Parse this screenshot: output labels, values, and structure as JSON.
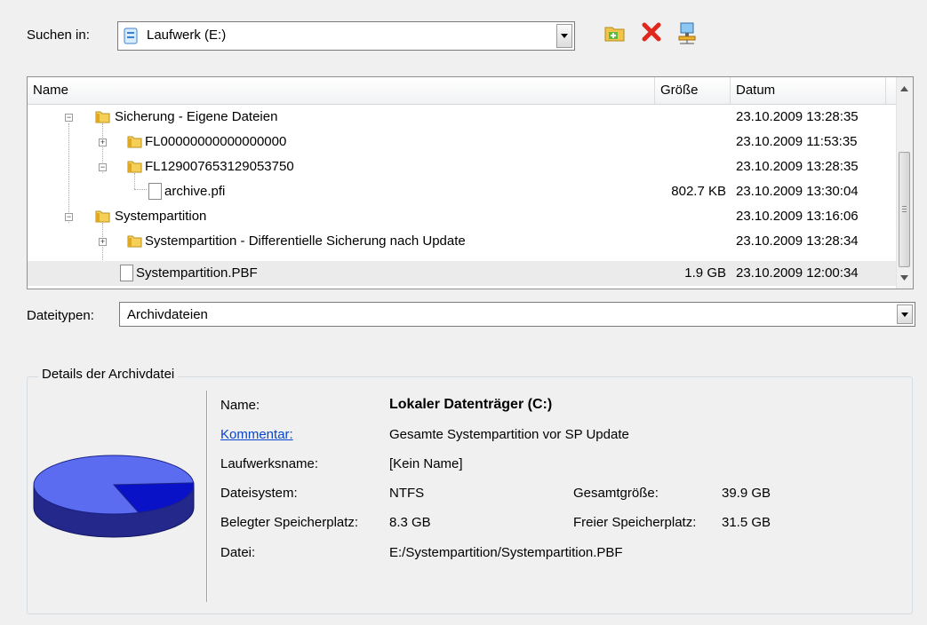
{
  "look_in": {
    "label": "Suchen in:",
    "value": "Laufwerk (E:)"
  },
  "toolbar": {
    "icons": [
      "new-folder-icon",
      "delete-icon",
      "network-icon"
    ]
  },
  "columns": {
    "name": "Name",
    "size": "Größe",
    "date": "Datum"
  },
  "rows": [
    {
      "name": "Sicherung - Eigene Dateien",
      "size": "",
      "date": "23.10.2009 13:28:35"
    },
    {
      "name": "FL00000000000000000",
      "size": "",
      "date": "23.10.2009 11:53:35"
    },
    {
      "name": "FL129007653129053750",
      "size": "",
      "date": "23.10.2009 13:28:35"
    },
    {
      "name": "archive.pfi",
      "size": "802.7 KB",
      "date": "23.10.2009 13:30:04"
    },
    {
      "name": "Systempartition",
      "size": "",
      "date": "23.10.2009 13:16:06"
    },
    {
      "name": "Systempartition - Differentielle Sicherung nach Update",
      "size": "",
      "date": "23.10.2009 13:28:34"
    },
    {
      "name": "Systempartition.PBF",
      "size": "1.9 GB",
      "date": "23.10.2009 12:00:34"
    }
  ],
  "filetypes": {
    "label": "Dateitypen:",
    "value": "Archivdateien"
  },
  "details": {
    "title": "Details der Archivdatei",
    "name_label": "Name:",
    "name_value": "Lokaler Datenträger (C:)",
    "comment_label": "Kommentar:",
    "comment_value": "Gesamte Systempartition vor SP Update",
    "drive_label": "Laufwerksname:",
    "drive_value": "[Kein Name]",
    "fs_label": "Dateisystem:",
    "fs_value": "NTFS",
    "total_label": "Gesamtgröße:",
    "total_value": "39.9 GB",
    "used_label": "Belegter Speicherplatz:",
    "used_value": "8.3 GB",
    "free_label": "Freier Speicherplatz:",
    "free_value": "31.5 GB",
    "file_label": "Datei:",
    "file_value": "E:/Systempartition/Systempartition.PBF",
    "used_fraction": 0.21,
    "colors": {
      "free": "#5b6cf0",
      "used": "#0a12c8"
    }
  }
}
